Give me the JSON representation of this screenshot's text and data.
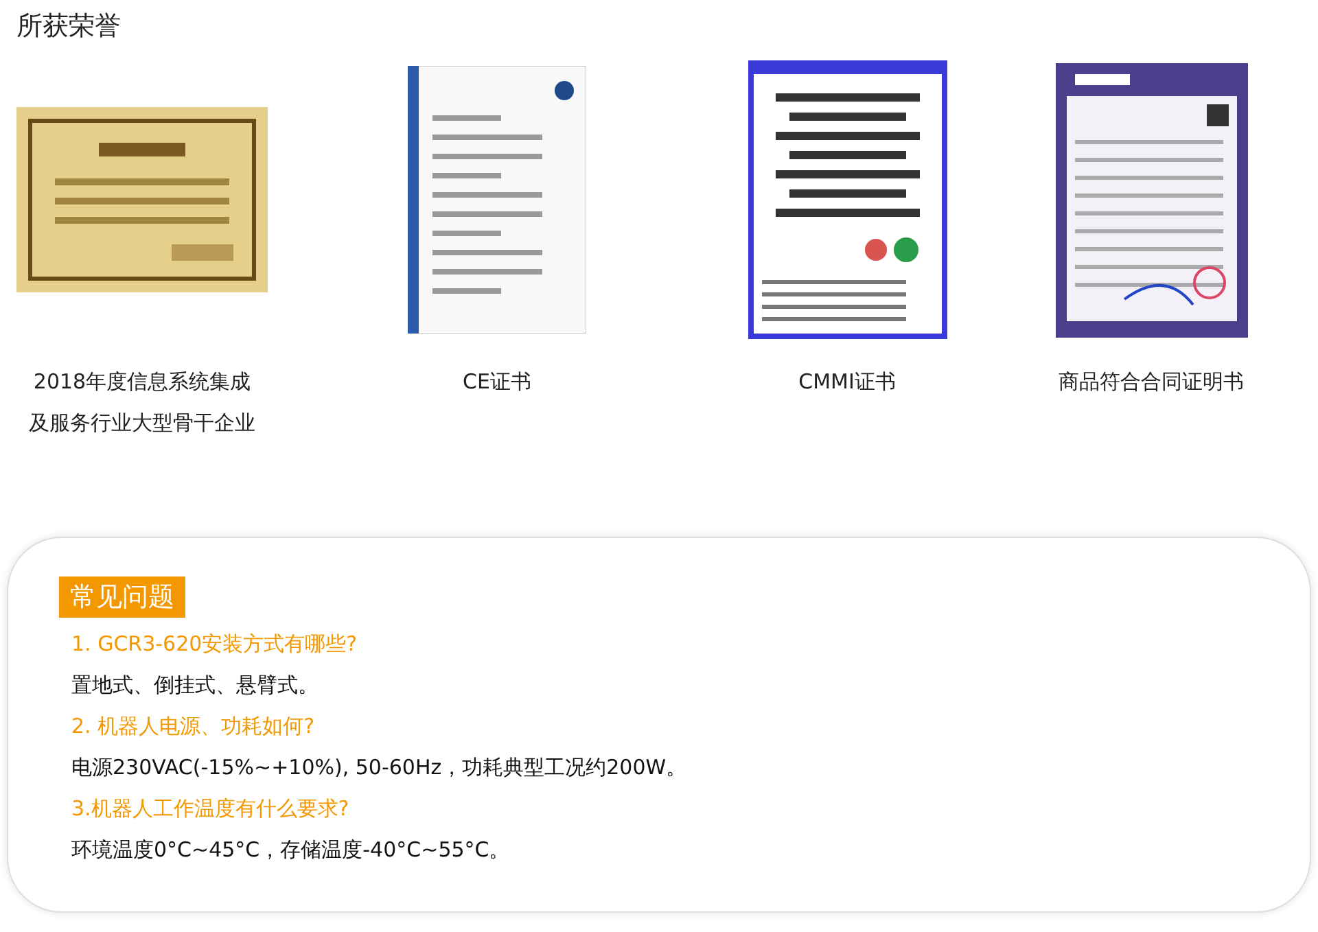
{
  "section_title": "所获荣誉",
  "awards": [
    {
      "kind": "picture",
      "caption_lines": [
        "2018年度信息系统集成",
        "及服务行业大型骨干企业"
      ]
    },
    {
      "kind": "picture",
      "caption_lines": [
        "CE证书"
      ]
    },
    {
      "kind": "picture",
      "caption_lines": [
        "CMMI证书"
      ]
    },
    {
      "kind": "picture",
      "caption_lines": [
        "商品符合合同证明书"
      ]
    }
  ],
  "faq": {
    "heading": "常见问题",
    "items": [
      {
        "question": "1. GCR3-620安装方式有哪些?",
        "answer": "置地式、倒挂式、悬臂式。"
      },
      {
        "question": "2. 机器人电源、功耗如何?",
        "answer": "电源230VAC(-15%~+10%), 50-60Hz，功耗典型工况约200W。"
      },
      {
        "question": "3.机器人工作温度有什么要求?",
        "answer": "环境温度0°C~45°C，存储温度-40°C~55°C。"
      }
    ]
  }
}
